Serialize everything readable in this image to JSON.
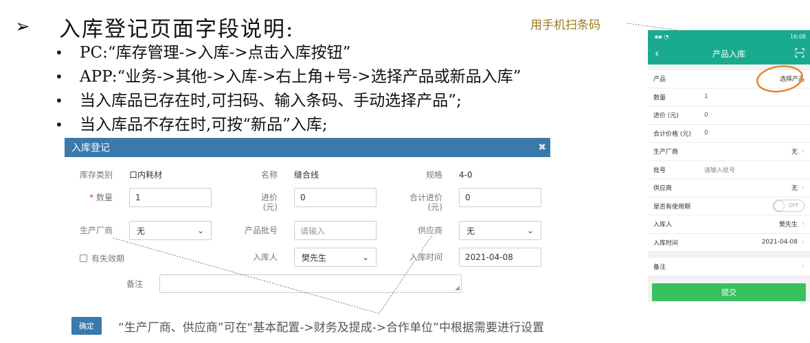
{
  "slide": {
    "heading_marker": "➢",
    "heading": "入库登记页面字段说明:",
    "bullets": [
      "PC:“库存管理->入库->点击入库按钮”",
      "APP:“业务->其他->入库->右上角+号->选择产品或新品入库”",
      "当入库品已存在时,可扫码、输入条码、手动选择产品”;",
      "当入库品不存在时,可按“新品”入库;"
    ],
    "bullet_symbol": "•",
    "scan_note": "用手机扫条码",
    "bottom_note": "“生产厂商、供应商”可在“基本配置->财务及提成->合作单位”中根据需要进行设置"
  },
  "dialog": {
    "title": "入库登记",
    "close_icon": "close-icon",
    "fields": {
      "category_label": "库存类别",
      "category_value": "口内耗材",
      "name_label": "名称",
      "name_value": "缝合线",
      "spec_label": "规格",
      "spec_value": "4-0",
      "qty_required_mark": "*",
      "qty_label": "数量",
      "qty_value": "1",
      "price_label_1": "进价",
      "price_label_2": "(元)",
      "price_value": "0",
      "total_label_1": "合计进价",
      "total_label_2": "(元)",
      "total_value": "0",
      "maker_label": "生产厂商",
      "maker_value": "无",
      "batch_label": "产品批号",
      "batch_placeholder": "请输入",
      "supplier_label": "供应商",
      "supplier_value": "无",
      "expiry_label": "有失效期",
      "receiver_label": "入库人",
      "receiver_value": "樊先生",
      "time_label": "入库时间",
      "time_value": "2021-04-08",
      "remark_label": "备注"
    },
    "confirm_label": "确定"
  },
  "app": {
    "status_right": "16:08",
    "title": "产品入库",
    "back_icon": "back-icon",
    "scan_icon": "scan-icon",
    "rows": [
      {
        "label": "产品",
        "right": "选择产品"
      },
      {
        "label": "数量",
        "value": "1"
      },
      {
        "label": "进价 (元)",
        "value": "0"
      },
      {
        "label": "合计价格 (元)",
        "value": "0"
      },
      {
        "label": "生产厂商",
        "right": "无"
      },
      {
        "label": "批号",
        "placeholder": "请输入批号"
      },
      {
        "label": "供应商",
        "right": "无"
      },
      {
        "label": "是否有使用期",
        "toggle": "OFF"
      },
      {
        "label": "入库人",
        "right": "樊先生"
      },
      {
        "label": "入库时间",
        "right": "2021-04-08"
      },
      {
        "label": "备注"
      }
    ],
    "submit_label": "提交"
  },
  "colors": {
    "dialog_header": "#3a79aa",
    "app_header": "#1aab8f",
    "submit": "#38c05e",
    "annotation_circle": "#e8852a",
    "scan_note": "#a0781a"
  }
}
